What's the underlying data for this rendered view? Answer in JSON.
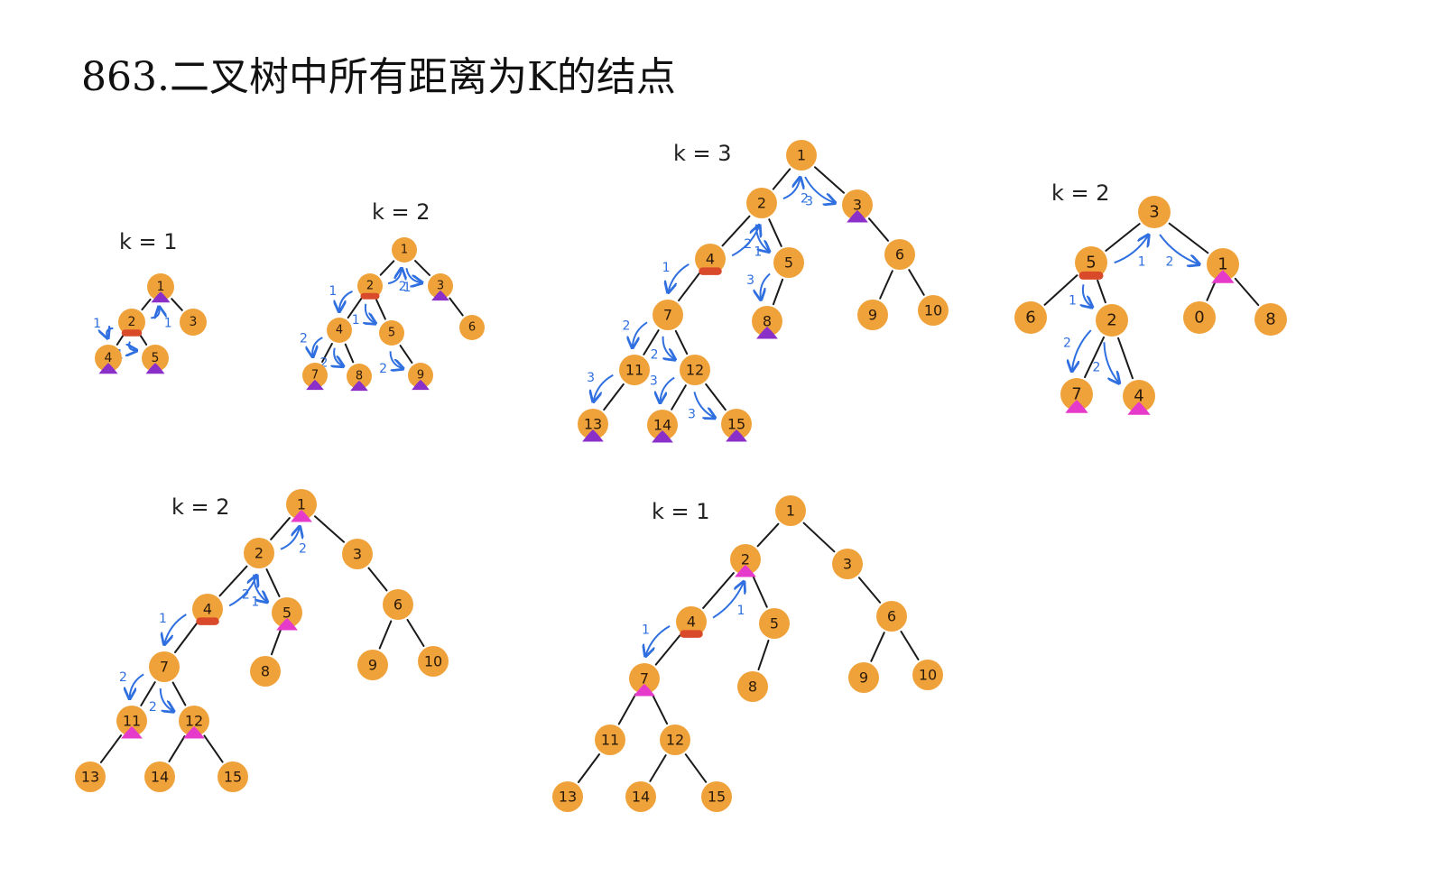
{
  "title": "863.二叉树中所有距离为K的结点",
  "colors": {
    "node": "#F0A23A",
    "edge": "#1a1a1a",
    "arrow": "#2f6fe0",
    "target_marker": "#D94A2B",
    "result_purple": "#8B2FC9",
    "result_pink": "#E63ACB"
  },
  "diagrams": [
    {
      "k_label": "k = 1",
      "nodes": [
        {
          "id": "1",
          "label": "1",
          "marker": "purple"
        },
        {
          "id": "2",
          "label": "2",
          "marker": "target"
        },
        {
          "id": "3",
          "label": "3"
        },
        {
          "id": "4",
          "label": "4",
          "marker": "purple"
        },
        {
          "id": "5",
          "label": "5",
          "marker": "purple"
        }
      ],
      "edges": [
        [
          "1",
          "2"
        ],
        [
          "1",
          "3"
        ],
        [
          "2",
          "4"
        ],
        [
          "2",
          "5"
        ]
      ],
      "arrows": [
        {
          "from": "2",
          "to": "1",
          "label": "1"
        },
        {
          "from": "2",
          "to": "4",
          "label": "1"
        },
        {
          "from": "2",
          "to": "5",
          "label": "1"
        }
      ]
    },
    {
      "k_label": "k = 2",
      "nodes": [
        {
          "id": "1",
          "label": "1"
        },
        {
          "id": "2",
          "label": "2",
          "marker": "target"
        },
        {
          "id": "3",
          "label": "3",
          "marker": "purple"
        },
        {
          "id": "4",
          "label": "4"
        },
        {
          "id": "5",
          "label": "5"
        },
        {
          "id": "6",
          "label": "6"
        },
        {
          "id": "7",
          "label": "7",
          "marker": "purple"
        },
        {
          "id": "8",
          "label": "8",
          "marker": "purple"
        },
        {
          "id": "9",
          "label": "9",
          "marker": "purple"
        }
      ],
      "edges": [
        [
          "1",
          "2"
        ],
        [
          "1",
          "3"
        ],
        [
          "2",
          "4"
        ],
        [
          "2",
          "5"
        ],
        [
          "3",
          "6"
        ],
        [
          "4",
          "7"
        ],
        [
          "4",
          "8"
        ],
        [
          "5",
          "9"
        ]
      ],
      "arrows": [
        {
          "from": "2",
          "to": "1",
          "label": "1"
        },
        {
          "from": "1",
          "to": "3",
          "label": "2"
        },
        {
          "from": "2",
          "to": "4",
          "label": "1"
        },
        {
          "from": "2",
          "to": "5",
          "label": "1"
        },
        {
          "from": "4",
          "to": "7",
          "label": "2"
        },
        {
          "from": "4",
          "to": "8",
          "label": "2"
        },
        {
          "from": "5",
          "to": "9",
          "label": "2"
        }
      ]
    },
    {
      "k_label": "k = 3",
      "nodes": [
        {
          "id": "1",
          "label": "1"
        },
        {
          "id": "2",
          "label": "2"
        },
        {
          "id": "3",
          "label": "3",
          "marker": "purple"
        },
        {
          "id": "4",
          "label": "4",
          "marker": "target"
        },
        {
          "id": "5",
          "label": "5"
        },
        {
          "id": "6",
          "label": "6"
        },
        {
          "id": "7",
          "label": "7"
        },
        {
          "id": "8",
          "label": "8",
          "marker": "purple"
        },
        {
          "id": "9",
          "label": "9"
        },
        {
          "id": "10",
          "label": "10"
        },
        {
          "id": "11",
          "label": "11"
        },
        {
          "id": "12",
          "label": "12"
        },
        {
          "id": "13",
          "label": "13",
          "marker": "purple"
        },
        {
          "id": "14",
          "label": "14",
          "marker": "purple"
        },
        {
          "id": "15",
          "label": "15",
          "marker": "purple"
        }
      ],
      "edges": [
        [
          "1",
          "2"
        ],
        [
          "1",
          "3"
        ],
        [
          "2",
          "4"
        ],
        [
          "2",
          "5"
        ],
        [
          "3",
          "6"
        ],
        [
          "4",
          "7"
        ],
        [
          "5",
          "8"
        ],
        [
          "6",
          "9"
        ],
        [
          "6",
          "10"
        ],
        [
          "7",
          "11"
        ],
        [
          "7",
          "12"
        ],
        [
          "11",
          "13"
        ],
        [
          "12",
          "14"
        ],
        [
          "12",
          "15"
        ]
      ],
      "arrows": [
        {
          "from": "4",
          "to": "2",
          "label": "1"
        },
        {
          "from": "2",
          "to": "1",
          "label": "2"
        },
        {
          "from": "1",
          "to": "3",
          "label": "3"
        },
        {
          "from": "2",
          "to": "5",
          "label": "2"
        },
        {
          "from": "5",
          "to": "8",
          "label": "3"
        },
        {
          "from": "4",
          "to": "7",
          "label": "1"
        },
        {
          "from": "7",
          "to": "11",
          "label": "2"
        },
        {
          "from": "7",
          "to": "12",
          "label": "2"
        },
        {
          "from": "11",
          "to": "13",
          "label": "3"
        },
        {
          "from": "12",
          "to": "14",
          "label": "3"
        },
        {
          "from": "12",
          "to": "15",
          "label": "3"
        }
      ]
    },
    {
      "k_label": "k = 2",
      "nodes": [
        {
          "id": "3",
          "label": "3"
        },
        {
          "id": "5",
          "label": "5",
          "marker": "target"
        },
        {
          "id": "1",
          "label": "1",
          "marker": "pink"
        },
        {
          "id": "6",
          "label": "6"
        },
        {
          "id": "2",
          "label": "2"
        },
        {
          "id": "0",
          "label": "0"
        },
        {
          "id": "8",
          "label": "8"
        },
        {
          "id": "7",
          "label": "7",
          "marker": "pink"
        },
        {
          "id": "4",
          "label": "4",
          "marker": "pink"
        }
      ],
      "edges": [
        [
          "3",
          "5"
        ],
        [
          "3",
          "1"
        ],
        [
          "5",
          "6"
        ],
        [
          "5",
          "2"
        ],
        [
          "1",
          "0"
        ],
        [
          "1",
          "8"
        ],
        [
          "2",
          "7"
        ],
        [
          "2",
          "4"
        ]
      ],
      "arrows": [
        {
          "from": "5",
          "to": "3",
          "label": "1"
        },
        {
          "from": "3",
          "to": "1",
          "label": "2"
        },
        {
          "from": "5",
          "to": "2",
          "label": "1"
        },
        {
          "from": "2",
          "to": "7",
          "label": "2"
        },
        {
          "from": "2",
          "to": "4",
          "label": "2"
        }
      ]
    },
    {
      "k_label": "k = 2",
      "nodes": [
        {
          "id": "1",
          "label": "1",
          "marker": "pink"
        },
        {
          "id": "2",
          "label": "2"
        },
        {
          "id": "3",
          "label": "3"
        },
        {
          "id": "4",
          "label": "4",
          "marker": "target"
        },
        {
          "id": "5",
          "label": "5",
          "marker": "pink"
        },
        {
          "id": "6",
          "label": "6"
        },
        {
          "id": "7",
          "label": "7"
        },
        {
          "id": "8",
          "label": "8"
        },
        {
          "id": "9",
          "label": "9"
        },
        {
          "id": "10",
          "label": "10"
        },
        {
          "id": "11",
          "label": "11",
          "marker": "pink"
        },
        {
          "id": "12",
          "label": "12",
          "marker": "pink"
        },
        {
          "id": "13",
          "label": "13"
        },
        {
          "id": "14",
          "label": "14"
        },
        {
          "id": "15",
          "label": "15"
        }
      ],
      "edges": [
        [
          "1",
          "2"
        ],
        [
          "1",
          "3"
        ],
        [
          "2",
          "4"
        ],
        [
          "2",
          "5"
        ],
        [
          "3",
          "6"
        ],
        [
          "4",
          "7"
        ],
        [
          "5",
          "8"
        ],
        [
          "6",
          "9"
        ],
        [
          "6",
          "10"
        ],
        [
          "7",
          "11"
        ],
        [
          "7",
          "12"
        ],
        [
          "11",
          "13"
        ],
        [
          "12",
          "14"
        ],
        [
          "12",
          "15"
        ]
      ],
      "arrows": [
        {
          "from": "4",
          "to": "2",
          "label": "1"
        },
        {
          "from": "2",
          "to": "1",
          "label": "2"
        },
        {
          "from": "2",
          "to": "5",
          "label": "2"
        },
        {
          "from": "4",
          "to": "7",
          "label": "1"
        },
        {
          "from": "7",
          "to": "11",
          "label": "2"
        },
        {
          "from": "7",
          "to": "12",
          "label": "2"
        }
      ]
    },
    {
      "k_label": "k = 1",
      "nodes": [
        {
          "id": "1",
          "label": "1"
        },
        {
          "id": "2",
          "label": "2",
          "marker": "pink"
        },
        {
          "id": "3",
          "label": "3"
        },
        {
          "id": "4",
          "label": "4",
          "marker": "target"
        },
        {
          "id": "5",
          "label": "5"
        },
        {
          "id": "6",
          "label": "6"
        },
        {
          "id": "7",
          "label": "7",
          "marker": "pink"
        },
        {
          "id": "8",
          "label": "8"
        },
        {
          "id": "9",
          "label": "9"
        },
        {
          "id": "10",
          "label": "10"
        },
        {
          "id": "11",
          "label": "11"
        },
        {
          "id": "12",
          "label": "12"
        },
        {
          "id": "13",
          "label": "13"
        },
        {
          "id": "14",
          "label": "14"
        },
        {
          "id": "15",
          "label": "15"
        }
      ],
      "edges": [
        [
          "1",
          "2"
        ],
        [
          "1",
          "3"
        ],
        [
          "2",
          "4"
        ],
        [
          "2",
          "5"
        ],
        [
          "3",
          "6"
        ],
        [
          "4",
          "7"
        ],
        [
          "5",
          "8"
        ],
        [
          "6",
          "9"
        ],
        [
          "6",
          "10"
        ],
        [
          "7",
          "11"
        ],
        [
          "7",
          "12"
        ],
        [
          "11",
          "13"
        ],
        [
          "12",
          "14"
        ],
        [
          "12",
          "15"
        ]
      ],
      "arrows": [
        {
          "from": "4",
          "to": "2",
          "label": "1"
        },
        {
          "from": "4",
          "to": "7",
          "label": "1"
        }
      ]
    }
  ]
}
